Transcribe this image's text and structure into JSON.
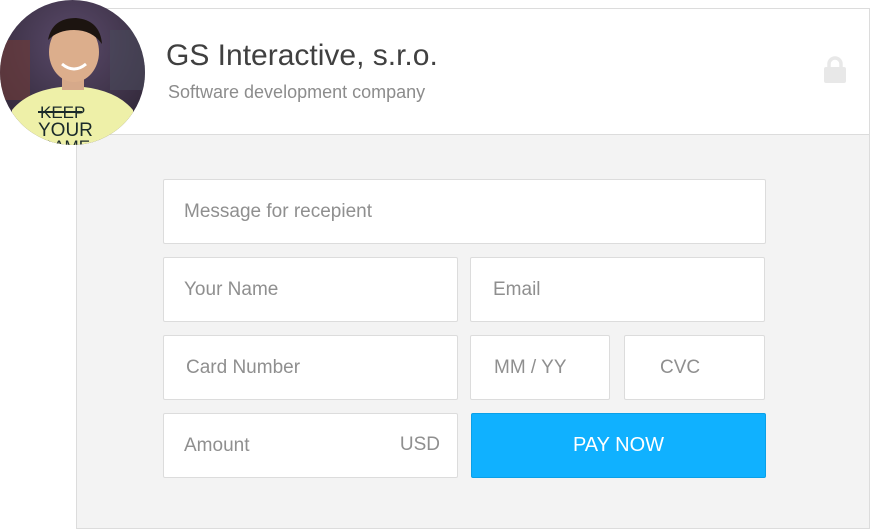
{
  "header": {
    "company_name": "GS Interactive, s.r.o.",
    "tagline": "Software development company",
    "lock_icon": "lock-icon",
    "avatar_shirt_text": [
      "KEEP",
      "YOUR",
      "GAME"
    ]
  },
  "form": {
    "message": {
      "placeholder": "Message for recepient",
      "value": ""
    },
    "name": {
      "placeholder": "Your Name",
      "value": ""
    },
    "email": {
      "placeholder": "Email",
      "value": ""
    },
    "card_number": {
      "placeholder": "Card Number",
      "value": ""
    },
    "expiry": {
      "placeholder": "MM / YY",
      "value": ""
    },
    "cvc": {
      "placeholder": "CVC",
      "value": ""
    },
    "amount": {
      "placeholder": "Amount",
      "value": "",
      "currency": "USD"
    },
    "pay_button_label": "PAY NOW"
  },
  "colors": {
    "accent": "#10b1ff",
    "panel_background": "#f3f3f3",
    "border": "#dcdcdc"
  }
}
